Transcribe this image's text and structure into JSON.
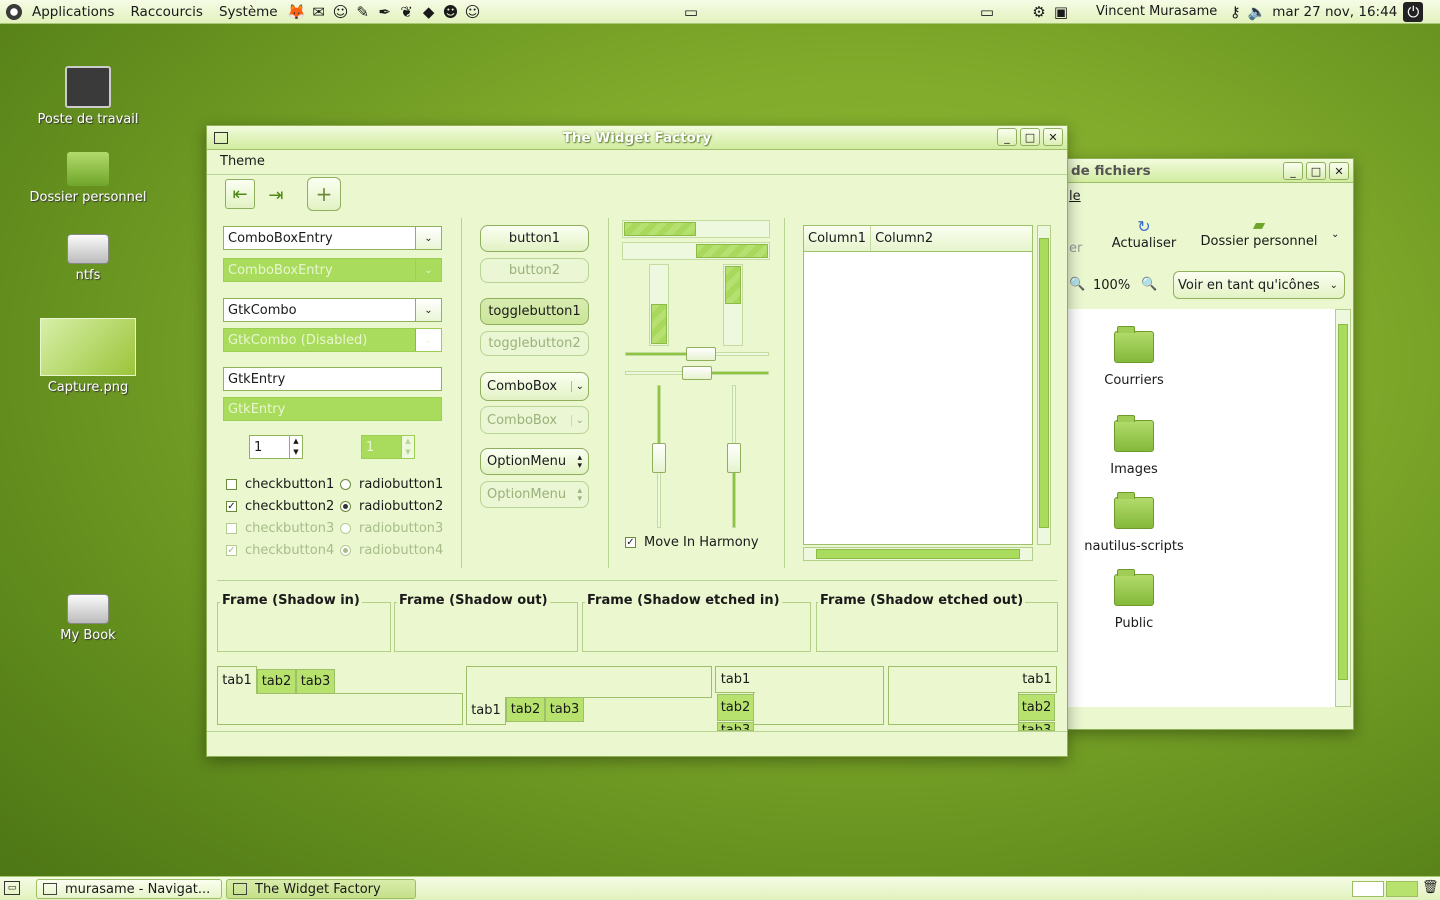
{
  "top_panel": {
    "menus": [
      "Applications",
      "Raccourcis",
      "Système"
    ],
    "user": "Vincent Murasame",
    "clock": "mar 27 nov, 16:44"
  },
  "desktop_icons": [
    "Poste de travail",
    "Dossier personnel",
    "ntfs",
    "Capture.png",
    "My Book"
  ],
  "taskbar": {
    "tasks": [
      "murasame - Navigat...",
      "The Widget Factory"
    ]
  },
  "file_manager": {
    "title": "de fichiers",
    "menu_fragment": "le",
    "toolbar_fragment": "er",
    "reload_label": "Actualiser",
    "home_label": "Dossier personnel",
    "zoom": "100%",
    "view_mode": "Voir en tant qu'icônes",
    "folders": [
      "Courriers",
      "Images",
      "nautilus-scripts",
      "Public"
    ]
  },
  "widget_factory": {
    "title": "The Widget Factory",
    "menu": "Theme",
    "combo_entry": "ComboBoxEntry",
    "combo_entry_disabled": "ComboBoxEntry",
    "gtk_combo": "GtkCombo",
    "gtk_combo_disabled": "GtkCombo (Disabled)",
    "gtk_entry": "GtkEntry",
    "gtk_entry_disabled": "GtkEntry",
    "spin1": "1",
    "spin2": "1",
    "checkbuttons": [
      "checkbutton1",
      "checkbutton2",
      "checkbutton3",
      "checkbutton4"
    ],
    "radiobuttons": [
      "radiobutton1",
      "radiobutton2",
      "radiobutton3",
      "radiobutton4"
    ],
    "button1": "button1",
    "button2": "button2",
    "togglebutton1": "togglebutton1",
    "togglebutton2": "togglebutton2",
    "combobox1": "ComboBox",
    "combobox2": "ComboBox",
    "optionmenu1": "OptionMenu",
    "optionmenu2": "OptionMenu",
    "move_in_harmony": "Move In Harmony",
    "columns": [
      "Column1",
      "Column2"
    ],
    "frames": [
      "Frame (Shadow in)",
      "Frame (Shadow out)",
      "Frame (Shadow etched in)",
      "Frame (Shadow etched out)"
    ],
    "tabs": [
      "tab1",
      "tab2",
      "tab3"
    ]
  },
  "colors": {
    "accent": "#a9dc5d",
    "panel": "#e2f1bd",
    "desktop": "#7ea92a"
  }
}
